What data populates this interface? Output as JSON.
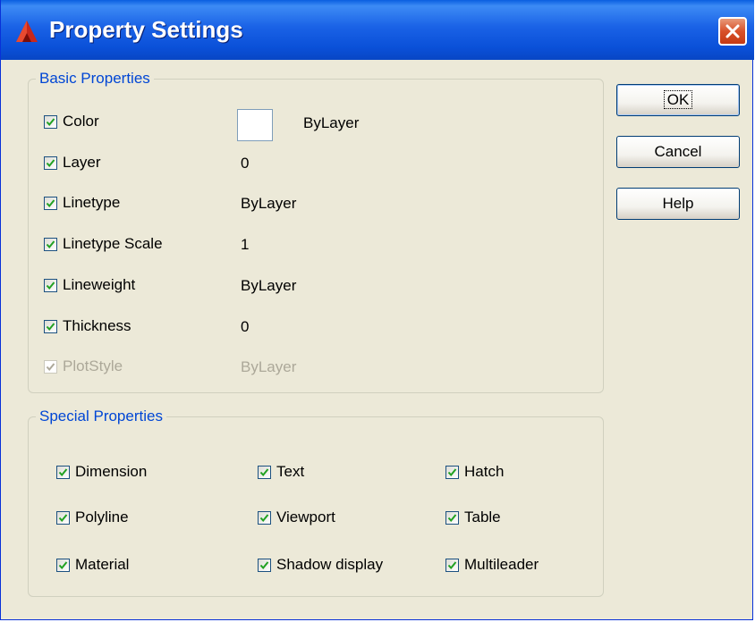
{
  "window": {
    "title": "Property Settings"
  },
  "basic": {
    "legend": "Basic Properties",
    "items": [
      {
        "label": "Color",
        "checked": true,
        "enabled": true,
        "value": "ByLayer",
        "swatch": "#ffffff"
      },
      {
        "label": "Layer",
        "checked": true,
        "enabled": true,
        "value": "0"
      },
      {
        "label": "Linetype",
        "checked": true,
        "enabled": true,
        "value": "ByLayer"
      },
      {
        "label": "Linetype Scale",
        "checked": true,
        "enabled": true,
        "value": "1"
      },
      {
        "label": "Lineweight",
        "checked": true,
        "enabled": true,
        "value": "ByLayer"
      },
      {
        "label": "Thickness",
        "checked": true,
        "enabled": true,
        "value": "0"
      },
      {
        "label": "PlotStyle",
        "checked": true,
        "enabled": false,
        "value": "ByLayer"
      }
    ]
  },
  "special": {
    "legend": "Special Properties",
    "items": [
      {
        "label": "Dimension",
        "checked": true
      },
      {
        "label": "Text",
        "checked": true
      },
      {
        "label": "Hatch",
        "checked": true
      },
      {
        "label": "Polyline",
        "checked": true
      },
      {
        "label": "Viewport",
        "checked": true
      },
      {
        "label": "Table",
        "checked": true
      },
      {
        "label": "Material",
        "checked": true
      },
      {
        "label": "Shadow display",
        "checked": true
      },
      {
        "label": "Multileader",
        "checked": true
      }
    ]
  },
  "buttons": {
    "ok": "OK",
    "cancel": "Cancel",
    "help": "Help"
  },
  "colors": {
    "accent": "#0046d5",
    "check": "#21a121",
    "titlebar": "#0a50d8"
  }
}
